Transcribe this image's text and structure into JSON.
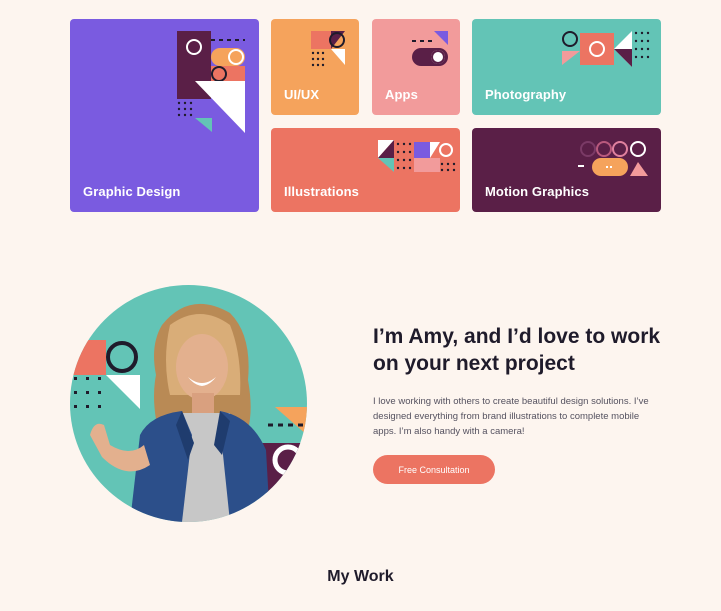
{
  "categories": [
    {
      "label": "Graphic Design",
      "color": "#7a5be0"
    },
    {
      "label": "UI/UX",
      "color": "#f5a35c"
    },
    {
      "label": "Apps",
      "color": "#f29b9b"
    },
    {
      "label": "Photography",
      "color": "#63c4b6"
    },
    {
      "label": "Illustrations",
      "color": "#ec7462"
    },
    {
      "label": "Motion Graphics",
      "color": "#5a1f47"
    }
  ],
  "about": {
    "headline": "I’m Amy, and I’d love to work on your next project",
    "bio": "I love working with others to create beautiful design solutions. I’ve designed everything from brand illustrations to complete mobile apps. I’m also handy with a camera!",
    "cta_label": "Free Consultation"
  },
  "work": {
    "title": "My Work"
  },
  "colors": {
    "background": "#fdf5ef",
    "accent": "#ec7462",
    "teal": "#63c4b6",
    "plum": "#5a1f47",
    "text": "#1f1b2b"
  }
}
